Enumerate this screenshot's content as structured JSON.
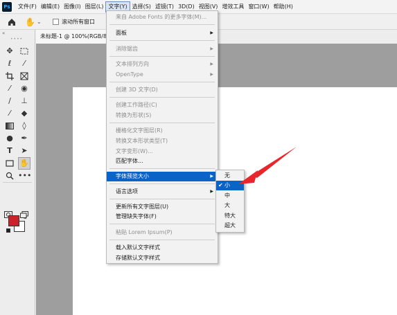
{
  "app": {
    "logo": "Ps"
  },
  "menubar": {
    "items": [
      {
        "label": "文件(F)"
      },
      {
        "label": "编辑(E)"
      },
      {
        "label": "图像(I)"
      },
      {
        "label": "图层(L)"
      },
      {
        "label": "文字(Y)",
        "active": true
      },
      {
        "label": "选择(S)"
      },
      {
        "label": "滤镜(T)"
      },
      {
        "label": "3D(D)"
      },
      {
        "label": "视图(V)"
      },
      {
        "label": "增效工具"
      },
      {
        "label": "窗口(W)"
      },
      {
        "label": "帮助(H)"
      }
    ]
  },
  "options": {
    "caret": "⌄",
    "scroll_all_windows": "滚动所有窗口",
    "scroll_all_checked": false
  },
  "toolbar": {
    "collapse": "«",
    "grip": "••••"
  },
  "document": {
    "tab_title": "未标题-1 @ 100%(RGB/8#"
  },
  "type_menu": {
    "items": [
      {
        "label": "来自 Adobe Fonts 的更多字体(M)...",
        "disabled": true
      },
      {
        "label": "面板",
        "submenu": true
      },
      {
        "label": "消除锯齿",
        "submenu": true,
        "disabled": true
      },
      {
        "label": "文本排列方向",
        "submenu": true,
        "disabled": true
      },
      {
        "label": "OpenType",
        "submenu": true,
        "disabled": true
      },
      {
        "label": "创建 3D 文字(D)",
        "disabled": true
      },
      {
        "label": "创建工作路径(C)",
        "disabled": true
      },
      {
        "label": "转换为形状(S)",
        "disabled": true
      },
      {
        "label": "栅格化文字图层(R)",
        "disabled": true
      },
      {
        "label": "转换文本形状类型(T)",
        "disabled": true
      },
      {
        "label": "文字变形(W)...",
        "disabled": true
      },
      {
        "label": "匹配字体..."
      },
      {
        "label": "字体预览大小",
        "submenu": true,
        "highlighted": true
      },
      {
        "label": "语言选项",
        "submenu": true
      },
      {
        "label": "更新所有文字图层(U)"
      },
      {
        "label": "管理缺失字体(F)"
      },
      {
        "label": "粘贴 Lorem Ipsum(P)",
        "disabled": true
      },
      {
        "label": "载入默认文字样式"
      },
      {
        "label": "存储默认文字样式"
      }
    ]
  },
  "font_preview_size_submenu": {
    "selected": "小",
    "items": [
      {
        "label": "无"
      },
      {
        "label": "小",
        "checked": true,
        "highlighted": true
      },
      {
        "label": "中"
      },
      {
        "label": "大"
      },
      {
        "label": "特大"
      },
      {
        "label": "超大"
      }
    ]
  },
  "colors": {
    "foreground": "#cc2229",
    "background": "#ffffff",
    "menu_highlight": "#0a64c8",
    "annotation_arrow": "#e8262b"
  }
}
